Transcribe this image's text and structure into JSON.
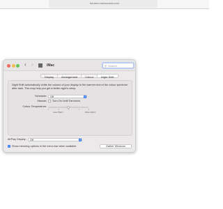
{
  "browser": {
    "url": "forums.macrumors.com"
  },
  "window": {
    "title": "iMac",
    "search_placeholder": "Search",
    "tabs": [
      {
        "label": "Display",
        "active": false
      },
      {
        "label": "Arrangement",
        "active": false
      },
      {
        "label": "Colour",
        "active": false
      },
      {
        "label": "Night Shift",
        "active": true
      }
    ],
    "night_shift": {
      "description": "Night Shift automatically shifts the colours of your display to the warmer end of the colour spectrum after dark. This may help you get a better night's sleep.",
      "schedule_label": "Schedule:",
      "schedule_value": "Off",
      "manual_label": "Manual:",
      "manual_button": "Turn On Until Tomorrow",
      "temperature_label": "Colour Temperature:",
      "temperature_level": 0.5,
      "less_warm": "Less Warm",
      "more_warm": "More Warm"
    },
    "airplay_label": "AirPlay Display:",
    "airplay_value": "Off",
    "mirroring_label": "Show mirroring options in the menu bar when available",
    "mirroring_checked": true,
    "gather_button": "Gather Windows"
  },
  "colors": {
    "accent": "#3a7bf6",
    "window_bg": "#ece9ea"
  }
}
